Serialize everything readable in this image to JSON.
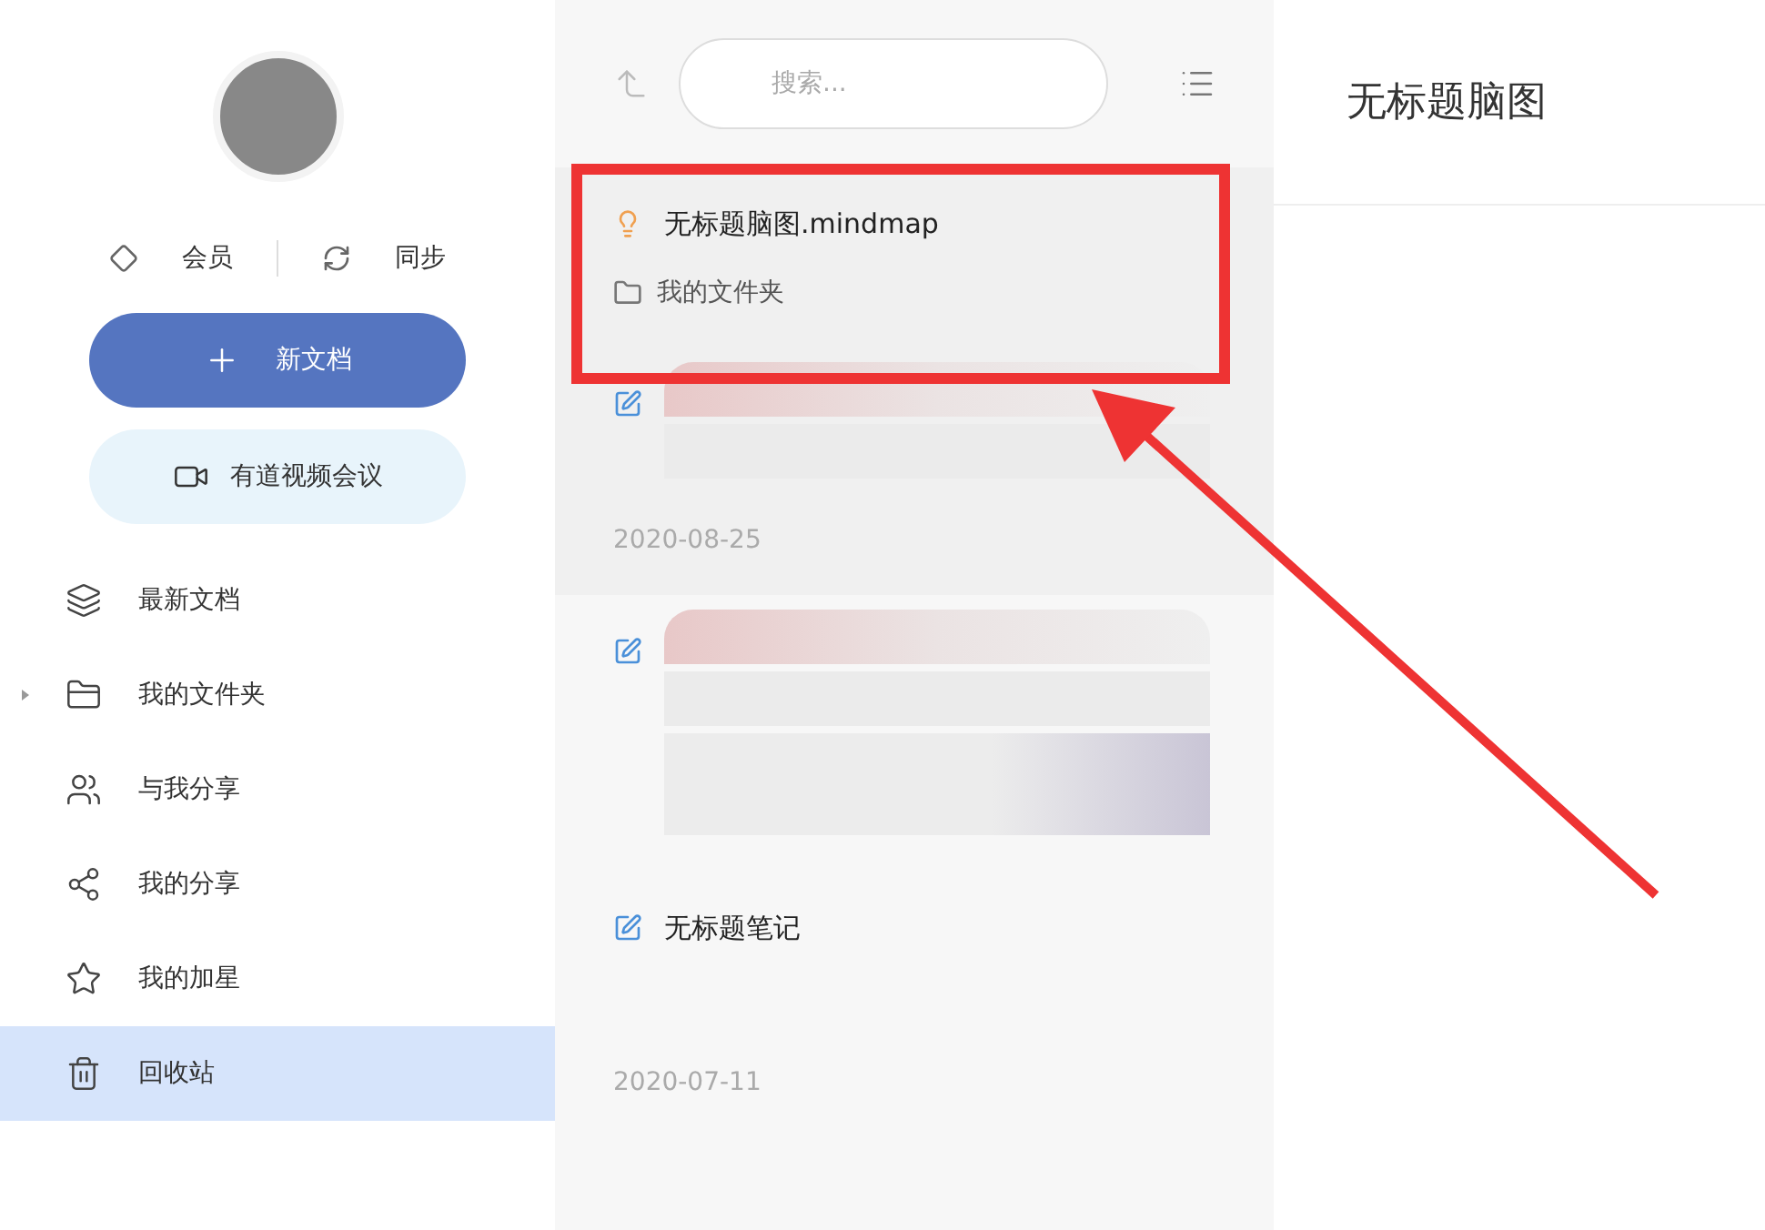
{
  "sidebar": {
    "member_label": "会员",
    "sync_label": "同步",
    "new_doc_button": "新文档",
    "meeting_button": "有道视频会议",
    "nav": [
      {
        "label": "最新文档",
        "selected": false
      },
      {
        "label": "我的文件夹",
        "selected": false,
        "expandable": true
      },
      {
        "label": "与我分享",
        "selected": false
      },
      {
        "label": "我的分享",
        "selected": false
      },
      {
        "label": "我的加星",
        "selected": false
      },
      {
        "label": "回收站",
        "selected": true
      }
    ]
  },
  "list": {
    "search": {
      "placeholder": "搜索..."
    },
    "items": [
      {
        "kind": "mindmap",
        "title": "无标题脑图.mindmap",
        "folder": "我的文件夹",
        "highlighted": true,
        "redacted": false
      },
      {
        "kind": "note",
        "redacted": true,
        "date": "2020-08-25",
        "highlighted": true
      },
      {
        "kind": "note",
        "redacted": true,
        "highlighted": false
      },
      {
        "kind": "note",
        "title": "无标题笔记",
        "date": "2020-07-11",
        "redacted": false,
        "highlighted": false
      }
    ]
  },
  "detail": {
    "title": "无标题脑图"
  }
}
